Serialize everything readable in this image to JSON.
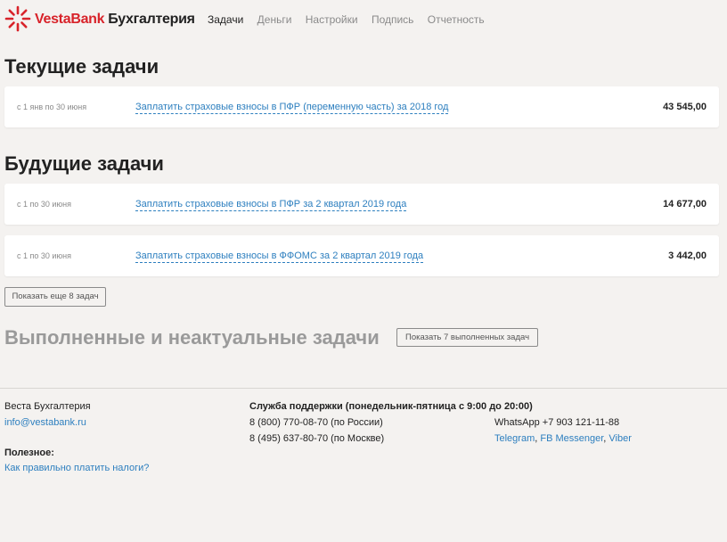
{
  "header": {
    "brand_main": "VestaBank",
    "brand_sub": "Бухгалтерия",
    "nav": [
      "Задачи",
      "Деньги",
      "Настройки",
      "Подпись",
      "Отчетность"
    ],
    "active_nav": "Задачи"
  },
  "current": {
    "title": "Текущие задачи",
    "tasks": [
      {
        "date": "с 1 янв по 30 июня",
        "title": "Заплатить страховые взносы в ПФР (переменную часть) за 2018 год",
        "amount": "43 545,00"
      }
    ]
  },
  "future": {
    "title": "Будущие задачи",
    "tasks": [
      {
        "date": "с 1 по 30 июня",
        "title": "Заплатить страховые взносы в ПФР за 2 квартал 2019 года",
        "amount": "14 677,00"
      },
      {
        "date": "с 1 по 30 июня",
        "title": "Заплатить страховые взносы в ФФОМС за 2 квартал 2019 года",
        "amount": "3 442,00"
      }
    ],
    "more_button": "Показать еще 8 задач"
  },
  "done": {
    "title": "Выполненные и неактуальные задачи",
    "button": "Показать 7 выполненных задач"
  },
  "footer": {
    "company": "Веста Бухгалтерия",
    "email": "info@vestabank.ru",
    "useful_label": "Полезное:",
    "useful_link": "Как правильно платить налоги?",
    "support_title": "Служба поддержки (понедельник-пятница с 9:00 до 20:00)",
    "phone_russia": "8 (800) 770-08-70 (по России)",
    "phone_moscow": "8 (495) 637-80-70 (по Москве)",
    "whatsapp": "WhatsApp +7 903 121-11-88",
    "telegram": "Telegram",
    "fb_messenger": "FB Messenger",
    "viber": "Viber",
    "sep": ","
  },
  "colors": {
    "accent": "#d8232a",
    "link": "#2d7fbf",
    "background": "#f4f2f0"
  }
}
